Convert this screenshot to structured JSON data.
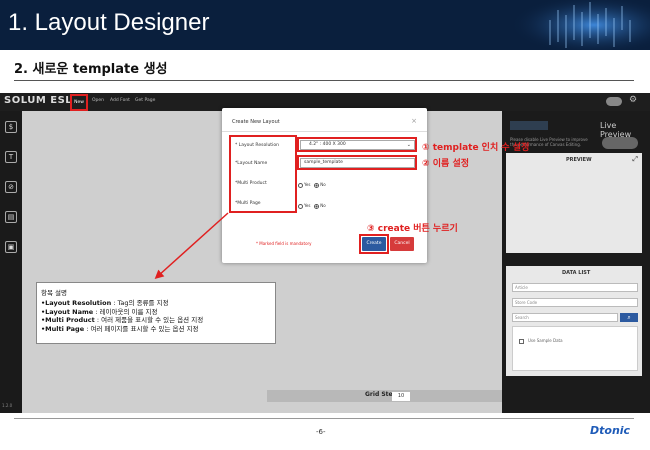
{
  "banner": {
    "title": "1. Layout Designer"
  },
  "section": {
    "title": "2. 새로운 template 생성"
  },
  "app": {
    "logo": "SOLUM ESL",
    "menu": [
      "New",
      "Open",
      "Add Font",
      "Get Page"
    ],
    "side_icons": [
      "$",
      "T",
      "⊘",
      "▤",
      "▣"
    ],
    "version": "1.2.0",
    "right_panel": {
      "live_preview_title": "Live Preview",
      "note": "Please disable Live Preview to improve the performance of Canvas Editing.",
      "preview_label": "PREVIEW",
      "data_list_label": "DATA LIST",
      "dl_select": "Article",
      "dl_store_code": "Store Code",
      "dl_search": "Search",
      "dl_use_sample": "Use Sample Data"
    },
    "grid_step_label": "Grid Step",
    "grid_step_value": "10"
  },
  "dialog": {
    "title": "Create New Layout",
    "close": "×",
    "fields": {
      "resolution_label": "* Layout Resolution",
      "resolution_value": "4.2\" : 400 X 300",
      "name_label": "*Layout Name",
      "name_value": "sample_template",
      "multi_product_label": "*Multi Product",
      "multi_page_label": "*Multi Page",
      "yes": "Yes",
      "no": "No"
    },
    "mandatory_note": "* Marked field is mandatory",
    "create": "Create",
    "cancel": "Cancel"
  },
  "annotations": {
    "a1": "① template 인치 수 설정",
    "a2": "② 이름 설정",
    "a3": "③ create 버튼 누르기"
  },
  "description": {
    "title": "항목 설명",
    "lines": [
      {
        "key": "•Layout Resolution",
        "text": " : Tag의 종류를 지정"
      },
      {
        "key": "•Layout Name",
        "text": " : 레이아웃의 이름 지정"
      },
      {
        "key": "•Multi Product",
        "text": " : 여러 제품을 표시할 수 있는 옵션 지정"
      },
      {
        "key": "•Multi Page",
        "text": " : 여러 페이지를 표시할 수 있는 옵션 지정"
      }
    ]
  },
  "footer": {
    "page": "-6-",
    "logo": "Dtonic"
  },
  "colors": {
    "accent_red": "#e02020",
    "banner": "#0a1f3d",
    "primary_blue": "#2c5aa0"
  }
}
